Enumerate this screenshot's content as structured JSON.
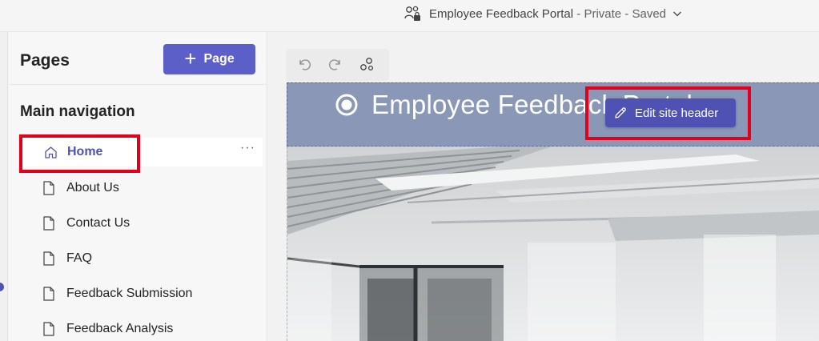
{
  "topbar": {
    "site_name": "Employee Feedback Portal",
    "separator": " - ",
    "privacy": "Private",
    "status": "Saved"
  },
  "pages_panel": {
    "title": "Pages",
    "add_button_label": "Page",
    "nav_heading": "Main navigation",
    "items": [
      {
        "label": "Home",
        "icon": "home-icon",
        "active": true
      },
      {
        "label": "About Us",
        "icon": "document-icon"
      },
      {
        "label": "Contact Us",
        "icon": "document-icon"
      },
      {
        "label": "FAQ",
        "icon": "document-icon"
      },
      {
        "label": "Feedback Submission",
        "icon": "document-icon"
      },
      {
        "label": "Feedback Analysis",
        "icon": "document-icon"
      }
    ],
    "more_label": "···"
  },
  "canvas": {
    "toolbar": [
      "undo-icon",
      "redo-icon",
      "share-icon"
    ],
    "header_title": "Employee Feedback Portal",
    "edit_header_label": "Edit site header"
  },
  "colors": {
    "accent": "#5b5fc7",
    "header_bg": "#8a97b6",
    "highlight": "#e3001b"
  }
}
